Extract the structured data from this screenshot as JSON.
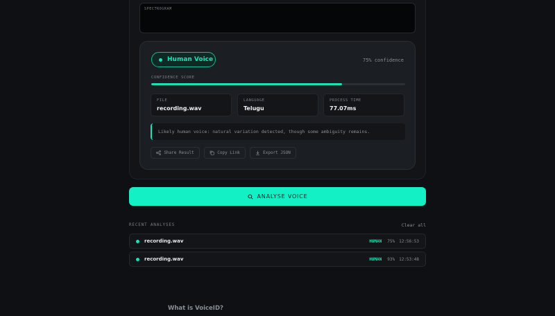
{
  "spectrogram": {
    "label": "SPECTROGRAM"
  },
  "result": {
    "verdict": "Human Voice",
    "confidence_text": "75% confidence",
    "score_label": "CONFIDENCE SCORE",
    "score_fraction": 0.75,
    "stats": [
      {
        "label": "FILE",
        "value": "recording.wav"
      },
      {
        "label": "LANGUAGE",
        "value": "Telugu"
      },
      {
        "label": "PROCESS TIME",
        "value": "77.07ms"
      }
    ],
    "note": "Likely human voice: natural variation detected, though some ambiguity remains.",
    "actions": [
      {
        "label": "Share Result",
        "icon": "share-icon"
      },
      {
        "label": "Copy Link",
        "icon": "copy-icon"
      },
      {
        "label": "Export JSON",
        "icon": "download-icon"
      }
    ]
  },
  "analyse_button": {
    "label": "ANALYSE VOICE",
    "icon": "search-icon"
  },
  "recent": {
    "title": "RECENT ANALYSES",
    "clear_label": "Clear all",
    "items": [
      {
        "file": "recording.wav",
        "tag": "HUMAN",
        "pct": "75%",
        "time": "12:56:53"
      },
      {
        "file": "recording.wav",
        "tag": "HUMAN",
        "pct": "93%",
        "time": "12:53:48"
      }
    ]
  },
  "footer": {
    "question": "What is VoiceID?"
  },
  "colors": {
    "accent": "#19e3b5",
    "button": "#14f0c5",
    "background": "#0e1013"
  }
}
